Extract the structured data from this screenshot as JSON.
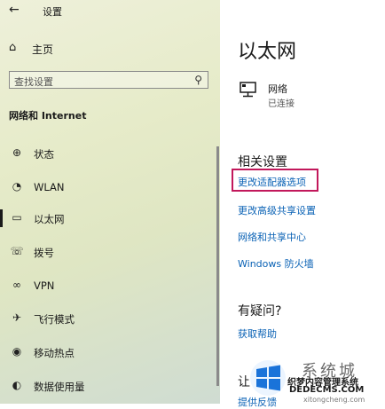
{
  "window": {
    "title": "设置"
  },
  "sidebar": {
    "home_label": "主页",
    "search_placeholder": "查找设置",
    "section_title": "网络和 Internet",
    "items": [
      {
        "label": "状态",
        "icon": "globe-icon"
      },
      {
        "label": "WLAN",
        "icon": "wifi-icon"
      },
      {
        "label": "以太网",
        "icon": "ethernet-icon",
        "active": true
      },
      {
        "label": "拨号",
        "icon": "dialup-icon"
      },
      {
        "label": "VPN",
        "icon": "vpn-icon"
      },
      {
        "label": "飞行模式",
        "icon": "airplane-icon"
      },
      {
        "label": "移动热点",
        "icon": "hotspot-icon"
      },
      {
        "label": "数据使用量",
        "icon": "data-usage-icon"
      }
    ]
  },
  "main": {
    "title": "以太网",
    "network": {
      "name": "网络",
      "status": "已连接"
    },
    "related_title": "相关设置",
    "links": [
      "更改适配器选项",
      "更改高级共享设置",
      "网络和共享中心",
      "Windows 防火墙"
    ],
    "question_title": "有疑问?",
    "help_link": "获取帮助",
    "partial_title": "让",
    "partial_link": "提供反馈"
  },
  "watermark": {
    "big_text": "系统城",
    "cn_text": "织梦内容管理系统",
    "url": "DEDECMS.COM",
    "sub": "xitongcheng.com"
  },
  "colors": {
    "link": "#0a62b5",
    "highlight_border": "#c2185b",
    "accent_bar": "#1a1a1a"
  }
}
